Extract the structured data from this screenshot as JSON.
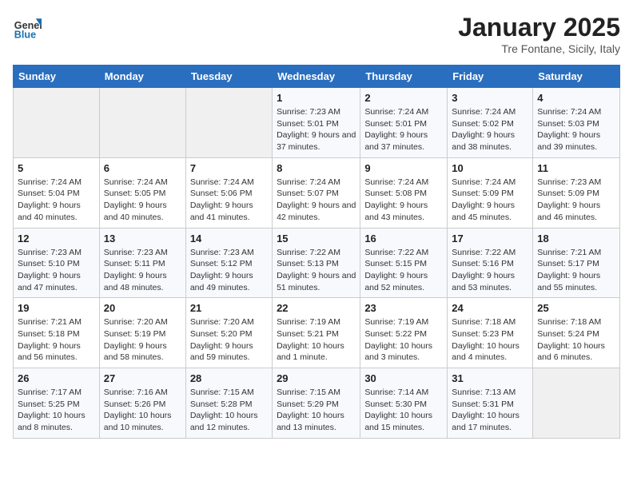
{
  "header": {
    "logo_line1": "General",
    "logo_line2": "Blue",
    "month": "January 2025",
    "location": "Tre Fontane, Sicily, Italy"
  },
  "weekdays": [
    "Sunday",
    "Monday",
    "Tuesday",
    "Wednesday",
    "Thursday",
    "Friday",
    "Saturday"
  ],
  "weeks": [
    [
      {
        "day": "",
        "info": ""
      },
      {
        "day": "",
        "info": ""
      },
      {
        "day": "",
        "info": ""
      },
      {
        "day": "1",
        "info": "Sunrise: 7:23 AM\nSunset: 5:01 PM\nDaylight: 9 hours and 37 minutes."
      },
      {
        "day": "2",
        "info": "Sunrise: 7:24 AM\nSunset: 5:01 PM\nDaylight: 9 hours and 37 minutes."
      },
      {
        "day": "3",
        "info": "Sunrise: 7:24 AM\nSunset: 5:02 PM\nDaylight: 9 hours and 38 minutes."
      },
      {
        "day": "4",
        "info": "Sunrise: 7:24 AM\nSunset: 5:03 PM\nDaylight: 9 hours and 39 minutes."
      }
    ],
    [
      {
        "day": "5",
        "info": "Sunrise: 7:24 AM\nSunset: 5:04 PM\nDaylight: 9 hours and 40 minutes."
      },
      {
        "day": "6",
        "info": "Sunrise: 7:24 AM\nSunset: 5:05 PM\nDaylight: 9 hours and 40 minutes."
      },
      {
        "day": "7",
        "info": "Sunrise: 7:24 AM\nSunset: 5:06 PM\nDaylight: 9 hours and 41 minutes."
      },
      {
        "day": "8",
        "info": "Sunrise: 7:24 AM\nSunset: 5:07 PM\nDaylight: 9 hours and 42 minutes."
      },
      {
        "day": "9",
        "info": "Sunrise: 7:24 AM\nSunset: 5:08 PM\nDaylight: 9 hours and 43 minutes."
      },
      {
        "day": "10",
        "info": "Sunrise: 7:24 AM\nSunset: 5:09 PM\nDaylight: 9 hours and 45 minutes."
      },
      {
        "day": "11",
        "info": "Sunrise: 7:23 AM\nSunset: 5:09 PM\nDaylight: 9 hours and 46 minutes."
      }
    ],
    [
      {
        "day": "12",
        "info": "Sunrise: 7:23 AM\nSunset: 5:10 PM\nDaylight: 9 hours and 47 minutes."
      },
      {
        "day": "13",
        "info": "Sunrise: 7:23 AM\nSunset: 5:11 PM\nDaylight: 9 hours and 48 minutes."
      },
      {
        "day": "14",
        "info": "Sunrise: 7:23 AM\nSunset: 5:12 PM\nDaylight: 9 hours and 49 minutes."
      },
      {
        "day": "15",
        "info": "Sunrise: 7:22 AM\nSunset: 5:13 PM\nDaylight: 9 hours and 51 minutes."
      },
      {
        "day": "16",
        "info": "Sunrise: 7:22 AM\nSunset: 5:15 PM\nDaylight: 9 hours and 52 minutes."
      },
      {
        "day": "17",
        "info": "Sunrise: 7:22 AM\nSunset: 5:16 PM\nDaylight: 9 hours and 53 minutes."
      },
      {
        "day": "18",
        "info": "Sunrise: 7:21 AM\nSunset: 5:17 PM\nDaylight: 9 hours and 55 minutes."
      }
    ],
    [
      {
        "day": "19",
        "info": "Sunrise: 7:21 AM\nSunset: 5:18 PM\nDaylight: 9 hours and 56 minutes."
      },
      {
        "day": "20",
        "info": "Sunrise: 7:20 AM\nSunset: 5:19 PM\nDaylight: 9 hours and 58 minutes."
      },
      {
        "day": "21",
        "info": "Sunrise: 7:20 AM\nSunset: 5:20 PM\nDaylight: 9 hours and 59 minutes."
      },
      {
        "day": "22",
        "info": "Sunrise: 7:19 AM\nSunset: 5:21 PM\nDaylight: 10 hours and 1 minute."
      },
      {
        "day": "23",
        "info": "Sunrise: 7:19 AM\nSunset: 5:22 PM\nDaylight: 10 hours and 3 minutes."
      },
      {
        "day": "24",
        "info": "Sunrise: 7:18 AM\nSunset: 5:23 PM\nDaylight: 10 hours and 4 minutes."
      },
      {
        "day": "25",
        "info": "Sunrise: 7:18 AM\nSunset: 5:24 PM\nDaylight: 10 hours and 6 minutes."
      }
    ],
    [
      {
        "day": "26",
        "info": "Sunrise: 7:17 AM\nSunset: 5:25 PM\nDaylight: 10 hours and 8 minutes."
      },
      {
        "day": "27",
        "info": "Sunrise: 7:16 AM\nSunset: 5:26 PM\nDaylight: 10 hours and 10 minutes."
      },
      {
        "day": "28",
        "info": "Sunrise: 7:15 AM\nSunset: 5:28 PM\nDaylight: 10 hours and 12 minutes."
      },
      {
        "day": "29",
        "info": "Sunrise: 7:15 AM\nSunset: 5:29 PM\nDaylight: 10 hours and 13 minutes."
      },
      {
        "day": "30",
        "info": "Sunrise: 7:14 AM\nSunset: 5:30 PM\nDaylight: 10 hours and 15 minutes."
      },
      {
        "day": "31",
        "info": "Sunrise: 7:13 AM\nSunset: 5:31 PM\nDaylight: 10 hours and 17 minutes."
      },
      {
        "day": "",
        "info": ""
      }
    ]
  ]
}
